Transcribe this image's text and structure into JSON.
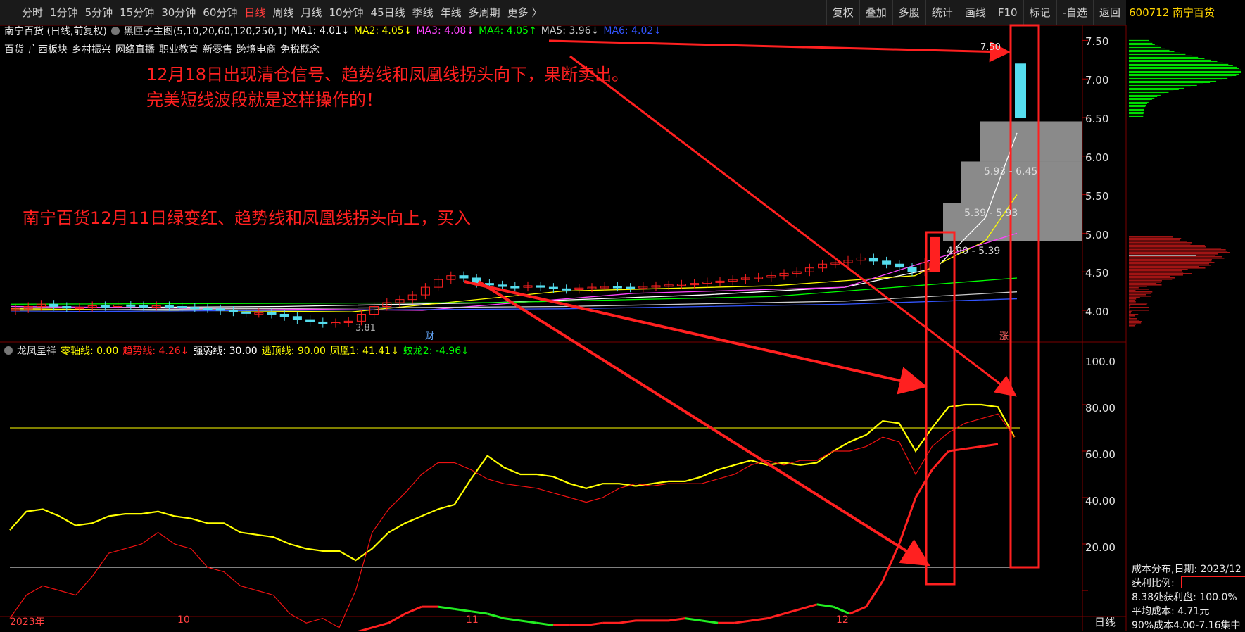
{
  "toolbar": {
    "timeframes": [
      "分时",
      "1分钟",
      "5分钟",
      "15分钟",
      "30分钟",
      "60分钟",
      "日线",
      "周线",
      "月线",
      "10分钟",
      "45日线",
      "季线",
      "年线",
      "多周期",
      "更多 〉"
    ],
    "active_index": 6,
    "tools": [
      "复权",
      "叠加",
      "多股",
      "统计",
      "画线",
      "F10",
      "标记",
      "-自选",
      "返回"
    ]
  },
  "stock": {
    "code": "600712",
    "name": "南宁百货",
    "header": "600712 南宁百货"
  },
  "main_chart": {
    "title": "南宁百货 (日线,前复权)",
    "indicator": "黑匣子主图(5,10,20,60,120,250,1)",
    "ma": [
      {
        "label": "MA1: 4.01↓",
        "color": "#ffffff"
      },
      {
        "label": "MA2: 4.05↓",
        "color": "#ffff00"
      },
      {
        "label": "MA3: 4.08↓",
        "color": "#ff44ff"
      },
      {
        "label": "MA4: 4.05↑",
        "color": "#00ff00"
      },
      {
        "label": "MA5: 3.96↓",
        "color": "#cccccc"
      },
      {
        "label": "MA6: 4.02↓",
        "color": "#3355ff"
      }
    ],
    "concepts": [
      "百货",
      "广西板块",
      "乡村振兴",
      "网络直播",
      "职业教育",
      "新零售",
      "跨境电商",
      "免税概念"
    ],
    "price_labels": [
      "7.50",
      "7.00",
      "6.50",
      "6.00",
      "5.50",
      "5.00",
      "4.50",
      "4.00"
    ],
    "low_label": "3.81",
    "high_label": "7.50",
    "zone_labels": [
      "5.93 - 6.45",
      "5.39 - 5.93",
      "4.90 - 5.39"
    ],
    "marker_cai": "财",
    "marker_zhang": "涨"
  },
  "annotations": {
    "sell_line1": "12月18日出现清仓信号、趋势线和凤凰线拐头向下，果断卖出。",
    "sell_line2": "完美短线波段就是这样操作的！",
    "buy": "南宁百货12月11日绿变红、趋势线和凤凰线拐头向上，买入"
  },
  "sub_chart": {
    "name": "龙凤呈祥",
    "items": [
      {
        "label": "零轴线: 0.00",
        "color": "#ffff00"
      },
      {
        "label": "趋势线: 4.26↓",
        "color": "#ff2020"
      },
      {
        "label": "强弱线: 30.00",
        "color": "#ffffff"
      },
      {
        "label": "逃顶线: 90.00",
        "color": "#ffff00"
      },
      {
        "label": "凤凰1: 41.41↓",
        "color": "#ffff00"
      },
      {
        "label": "蛟龙2: -4.96↓",
        "color": "#00ff00"
      }
    ],
    "y_labels": [
      "100.0",
      "80.00",
      "60.00",
      "40.00",
      "20.00"
    ]
  },
  "x_axis": [
    "2023年",
    "10",
    "11",
    "12"
  ],
  "x_axis_right": "日线",
  "right_panel": {
    "cost_date": "成本分布,日期: 2023/12",
    "profit_ratio": "获利比例:",
    "profit_at": "8.38处获利盘: 100.0%",
    "avg_cost": "平均成本: 4.71元",
    "cost90": "90%成本4.00-7.16集中"
  },
  "colors": {
    "up": "#ff2020",
    "down": "#55ddee",
    "annotation": "#ff2020",
    "grid": "#5a0000"
  }
}
